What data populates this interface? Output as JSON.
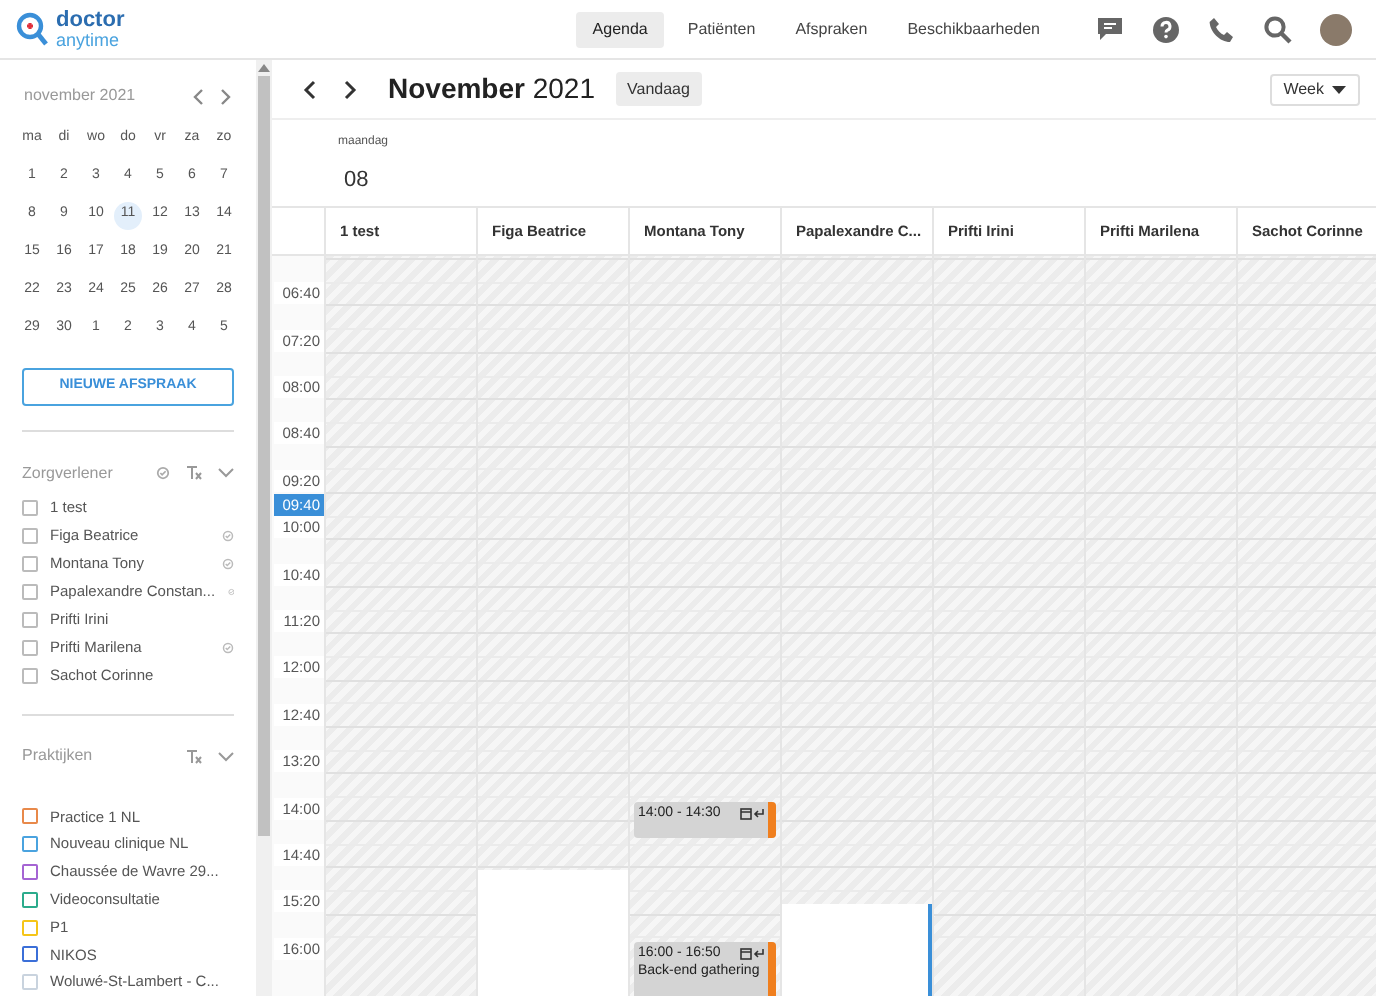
{
  "logo": {
    "line1": "doctor",
    "line2": "anytime"
  },
  "nav": [
    {
      "label": "Agenda",
      "selected": true
    },
    {
      "label": "Patiënten",
      "selected": false
    },
    {
      "label": "Afspraken",
      "selected": false
    },
    {
      "label": "Beschikbaarheden",
      "selected": false
    }
  ],
  "mini_calendar": {
    "title": "november 2021",
    "weekdays": [
      "ma",
      "di",
      "wo",
      "do",
      "vr",
      "za",
      "zo"
    ],
    "weeks": [
      [
        {
          "day": "1",
          "selected": false
        },
        {
          "day": "2",
          "selected": false
        },
        {
          "day": "3",
          "selected": false
        },
        {
          "day": "4",
          "selected": false
        },
        {
          "day": "5",
          "selected": false
        },
        {
          "day": "6",
          "selected": false
        },
        {
          "day": "7",
          "selected": false
        }
      ],
      [
        {
          "day": "8",
          "selected": false
        },
        {
          "day": "9",
          "selected": false
        },
        {
          "day": "10",
          "selected": false
        },
        {
          "day": "11",
          "selected": true
        },
        {
          "day": "12",
          "selected": false
        },
        {
          "day": "13",
          "selected": false
        },
        {
          "day": "14",
          "selected": false
        }
      ],
      [
        {
          "day": "15",
          "selected": false
        },
        {
          "day": "16",
          "selected": false
        },
        {
          "day": "17",
          "selected": false
        },
        {
          "day": "18",
          "selected": false
        },
        {
          "day": "19",
          "selected": false
        },
        {
          "day": "20",
          "selected": false
        },
        {
          "day": "21",
          "selected": false
        }
      ],
      [
        {
          "day": "22",
          "selected": false
        },
        {
          "day": "23",
          "selected": false
        },
        {
          "day": "24",
          "selected": false
        },
        {
          "day": "25",
          "selected": false
        },
        {
          "day": "26",
          "selected": false
        },
        {
          "day": "27",
          "selected": false
        },
        {
          "day": "28",
          "selected": false
        }
      ],
      [
        {
          "day": "29",
          "selected": false
        },
        {
          "day": "30",
          "selected": false
        },
        {
          "day": "1",
          "selected": false
        },
        {
          "day": "2",
          "selected": false
        },
        {
          "day": "3",
          "selected": false
        },
        {
          "day": "4",
          "selected": false
        },
        {
          "day": "5",
          "selected": false
        }
      ]
    ]
  },
  "new_appointment_button": "NIEUWE AFSPRAAK",
  "providers": {
    "title": "Zorgverlener",
    "items": [
      {
        "name": "1 test",
        "checked": false,
        "synced": false
      },
      {
        "name": "Figa Beatrice",
        "checked": false,
        "synced": true
      },
      {
        "name": "Montana Tony",
        "checked": false,
        "synced": true
      },
      {
        "name": "Papalexandre Constan...",
        "checked": false,
        "synced": true
      },
      {
        "name": "Prifti Irini",
        "checked": false,
        "synced": false
      },
      {
        "name": "Prifti Marilena",
        "checked": false,
        "synced": true
      },
      {
        "name": "Sachot Corinne",
        "checked": false,
        "synced": false
      }
    ]
  },
  "practices": {
    "title": "Praktijken",
    "items": [
      {
        "name": "Practice 1 NL",
        "checked": false,
        "color": "#e8894a"
      },
      {
        "name": "Nouveau clinique NL",
        "checked": false,
        "color": "#4aa3df"
      },
      {
        "name": "Chaussée de Wavre 29...",
        "checked": false,
        "color": "#a564d3"
      },
      {
        "name": "Videoconsultatie",
        "checked": false,
        "color": "#2bab8c"
      },
      {
        "name": "P1",
        "checked": false,
        "color": "#f5c518"
      },
      {
        "name": "NIKOS",
        "checked": false,
        "color": "#3b6fd8"
      },
      {
        "name": "Woluwé-St-Lambert - C...",
        "checked": false,
        "color": "#c9d3de"
      }
    ]
  },
  "toolbar": {
    "month": "November",
    "year": "2021",
    "today_button": "Vandaag",
    "view": "Week"
  },
  "day_header": {
    "weekday": "maandag",
    "date": "08"
  },
  "time_labels": [
    "06:40",
    "07:20",
    "08:00",
    "08:40",
    "09:20",
    "10:00",
    "10:40",
    "11:20",
    "12:00",
    "12:40",
    "13:20",
    "14:00",
    "14:40",
    "15:20",
    "16:00"
  ],
  "now": "09:40",
  "columns": [
    {
      "name": "1 test"
    },
    {
      "name": "Figa Beatrice",
      "availability": {
        "level": 0.17
      }
    },
    {
      "name": "Montana Tony",
      "events": [
        {
          "time": "14:00 - 14:30",
          "color": "#f07f1e"
        },
        {
          "time": "16:00 - 16:50",
          "title": "Back-end gathering",
          "color": "#f07f1e"
        }
      ]
    },
    {
      "name": "Papalexandre C...",
      "availability": {
        "level": 0.124
      }
    },
    {
      "name": "Prifti Irini"
    },
    {
      "name": "Prifti Marilena"
    },
    {
      "name": "Sachot Corinne"
    }
  ]
}
